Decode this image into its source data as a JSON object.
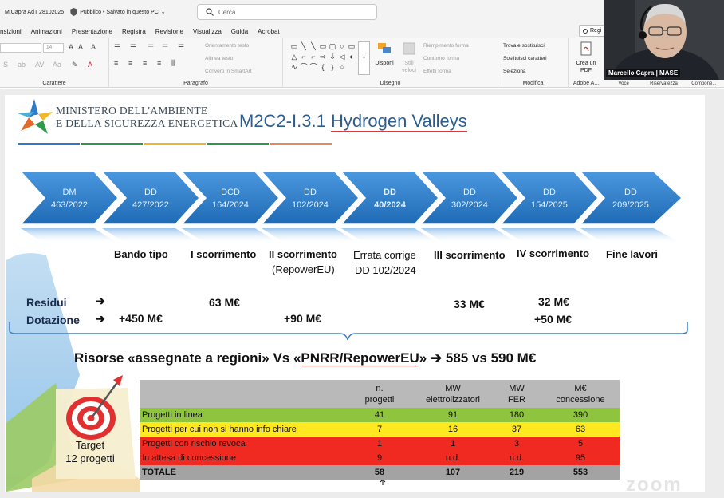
{
  "window": {
    "file_title": "M.Capra AdT 28102025",
    "status": "Pubblico • Salvato in questo PC",
    "search_placeholder": "Cerca"
  },
  "ribbon_tabs": [
    "nsizioni",
    "Animazioni",
    "Presentazione",
    "Registra",
    "Revisione",
    "Visualizza",
    "Guida",
    "Acrobat"
  ],
  "record_button": "Regi",
  "ribbon": {
    "font_size": "14",
    "groups": {
      "carattere": "Carattere",
      "paragrafo": "Paragrafo",
      "disegno": "Disegno",
      "modifica": "Modifica",
      "adobe": "Adobe A..."
    },
    "orientamento": "Orientamento testo",
    "allinea": "Allinea testo",
    "converti": "Converti in SmartArt",
    "disponi": "Disponi",
    "stili_rapidi": "Stili veloci",
    "riempimento": "Riempimento forma",
    "contorno": "Contorno forma",
    "effetti": "Effetti forma",
    "trova": "Trova e sostituisci",
    "sostituisci": "Sostituisci caratteri",
    "seleziona": "Seleziona",
    "crea_pdf": "Crea un PDF",
    "tail": [
      "Voce",
      "Riservatezza",
      "Compone..."
    ]
  },
  "webcam": {
    "name": "Marcello Capra | MASE"
  },
  "slide": {
    "logo_line1": "MINISTERO DELL'AMBIENTE",
    "logo_line2": "E DELLA SICUREZZA ENERGETICA",
    "title_prefix": "M2C2-I.3.1 ",
    "title_main": "Hydrogen Valleys",
    "arrows": [
      {
        "line1": "DM",
        "line2": "463/2022"
      },
      {
        "line1": "DD",
        "line2": "427/2022"
      },
      {
        "line1": "DCD",
        "line2": "164/2024"
      },
      {
        "line1": "DD",
        "line2": "102/2024"
      },
      {
        "line1": "DD",
        "line2": "40/2024"
      },
      {
        "line1": "DD",
        "line2": "302/2024"
      },
      {
        "line1": "DD",
        "line2": "154/2025"
      },
      {
        "line1": "DD",
        "line2": "209/2025"
      }
    ],
    "milestones": {
      "bando": "Bando tipo",
      "scorr1": "I scorrimento",
      "scorr2": "II scorrimento",
      "scorr2_sub": "(RepowerEU)",
      "errata1": "Errata corrige",
      "errata2": "DD 102/2024",
      "scorr3": "III scorrimento",
      "scorr4": "IV scorrimento",
      "fine": "Fine lavori"
    },
    "residui_label": "Residui",
    "dotazione_label": "Dotazione",
    "arrow_glyph": "➔",
    "values": {
      "dot_450": "+450 M€",
      "res_63": "63 M€",
      "dot_90": "+90 M€",
      "res_33": "33 M€",
      "res_32": "32 M€",
      "dot_50": "+50 M€"
    },
    "risorse": {
      "part1": "Risorse «assegnate a regioni»  Vs «",
      "part2": "PNRR/RepowerEU",
      "part3": "» ➔ 585 vs 590 M€"
    },
    "target": {
      "line1": "Target",
      "line2": "12 progetti"
    },
    "table": {
      "headers": [
        {
          "l1": "",
          "l2": ""
        },
        {
          "l1": "n.",
          "l2": "progetti"
        },
        {
          "l1": "MW",
          "l2": "elettrolizzatori"
        },
        {
          "l1": "MW",
          "l2": "FER"
        },
        {
          "l1": "M€",
          "l2": "concessione"
        }
      ],
      "rows": [
        [
          "Progetti in linea",
          "41",
          "91",
          "180",
          "390"
        ],
        [
          "Progetti per cui non si hanno info chiare",
          "7",
          "16",
          "37",
          "63"
        ],
        [
          "Progetti con rischio revoca",
          "1",
          "1",
          "3",
          "5"
        ],
        [
          "In attesa di concessione",
          "9",
          "n.d.",
          "n.d.",
          "95"
        ],
        [
          "TOTALE",
          "58",
          "107",
          "219",
          "553"
        ]
      ]
    },
    "watermark": "zoom"
  },
  "colors": {
    "arrow_blue": "#2f7ec9",
    "title_blue": "#2d5d8f",
    "green_row": "#8fc43e",
    "yellow_row": "#ffe81f",
    "red_row": "#f02a20",
    "header_gray": "#b9b9b9"
  }
}
